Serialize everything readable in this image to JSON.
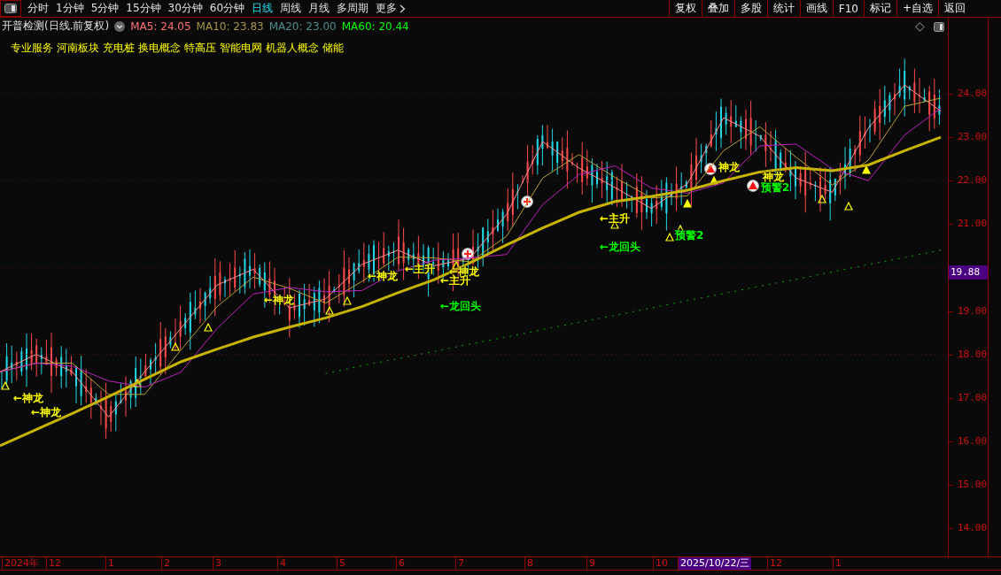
{
  "toolbar": {
    "periods": [
      {
        "label": "分时",
        "selected": false
      },
      {
        "label": "1分钟",
        "selected": false
      },
      {
        "label": "5分钟",
        "selected": false
      },
      {
        "label": "15分钟",
        "selected": false
      },
      {
        "label": "30分钟",
        "selected": false
      },
      {
        "label": "60分钟",
        "selected": false
      },
      {
        "label": "日线",
        "selected": true
      },
      {
        "label": "周线",
        "selected": false
      },
      {
        "label": "月线",
        "selected": false
      },
      {
        "label": "多周期",
        "selected": false
      },
      {
        "label": "更多",
        "selected": false
      }
    ],
    "buttons": [
      "复权",
      "叠加",
      "多股",
      "统计",
      "画线",
      "F10",
      "标记",
      "+自选",
      "返回"
    ]
  },
  "chart": {
    "title": "开普检测(日线.前复权)",
    "ma": [
      {
        "label": "MA5: 24.05",
        "color": "#ff7070"
      },
      {
        "label": "MA10: 23.83",
        "color": "#a89448"
      },
      {
        "label": "MA20: 23.00",
        "color": "#4f8c8c"
      },
      {
        "label": "MA60: 20.44",
        "color": "#00ff00"
      }
    ],
    "concepts": [
      "专业服务",
      "河南板块",
      "充电桩",
      "换电概念",
      "特高压",
      "智能电网",
      "机器人概念",
      "储能"
    ],
    "signals": [
      {
        "text": "←神龙",
        "color": "#ffff00"
      },
      {
        "text": "←神龙",
        "color": "#ffff00"
      },
      {
        "text": "←神龙",
        "color": "#ffff00"
      },
      {
        "text": "←神龙",
        "color": "#ffff00"
      },
      {
        "text": "←主升",
        "color": "#ffff00"
      },
      {
        "text": "←神龙",
        "color": "#ffff00"
      },
      {
        "text": "←主升",
        "color": "#ffff00"
      },
      {
        "text": "←龙回头",
        "color": "#00ff00"
      },
      {
        "text": "←主升",
        "color": "#ffff00"
      },
      {
        "text": "←龙回头",
        "color": "#00ff00"
      },
      {
        "text": "预警2",
        "color": "#00ff00"
      },
      {
        "text": "神龙",
        "color": "#ffff00"
      },
      {
        "text": "神龙",
        "color": "#ffff00"
      },
      {
        "text": "预警2",
        "color": "#00ff00"
      }
    ]
  },
  "chart_data": {
    "type": "line",
    "ylim": [
      13.33,
      25.75
    ],
    "grid": true,
    "yticks": [
      {
        "value": 24,
        "label": "24.00"
      },
      {
        "value": 23,
        "label": "23.00"
      },
      {
        "value": 22,
        "label": "22.00"
      },
      {
        "value": 21,
        "label": "21.00"
      },
      {
        "value": 19,
        "label": "19.00"
      },
      {
        "value": 18,
        "label": "18.00"
      },
      {
        "value": 17,
        "label": "17.00"
      },
      {
        "value": 16,
        "label": "16.00"
      },
      {
        "value": 15,
        "label": "15.00"
      },
      {
        "value": 14,
        "label": "14.00"
      }
    ],
    "series": [
      {
        "color": "#ff8a8a",
        "values": [
          17.6,
          18.0,
          17.6,
          16.56,
          17.6,
          18.6,
          19.6,
          19.96,
          19.07,
          19.28,
          20.07,
          20.4,
          20.04,
          20.22,
          21.22,
          22.9,
          22.29,
          21.84,
          21.36,
          21.93,
          23.45,
          23.02,
          22.06,
          21.73,
          23.21,
          24.2,
          23.6
        ]
      },
      {
        "color": "#b8a030",
        "values": [
          17.6,
          17.8,
          17.8,
          17.08,
          17.08,
          18.1,
          19.1,
          19.78,
          19.52,
          19.18,
          19.68,
          20.24,
          20.22,
          20.13,
          20.72,
          22.06,
          22.6,
          22.07,
          21.6,
          21.65,
          22.69,
          23.24,
          22.54,
          21.9,
          22.47,
          23.71,
          23.9
        ]
      },
      {
        "color": "#c020c0",
        "values": [
          17.6,
          17.8,
          17.73,
          17.39,
          17.25,
          17.59,
          18.6,
          19.39,
          19.54,
          19.44,
          19.47,
          19.92,
          20.17,
          20.22,
          20.3,
          21.45,
          22.14,
          22.34,
          21.83,
          21.71,
          21.95,
          22.8,
          22.84,
          22.27,
          22.0,
          23.05,
          23.67
        ]
      },
      {
        "color": "#c8b400",
        "values": [
          15.9,
          16.27,
          16.64,
          17.03,
          17.43,
          17.83,
          18.12,
          18.4,
          18.63,
          18.84,
          19.1,
          19.42,
          19.72,
          20.11,
          20.52,
          20.91,
          21.27,
          21.52,
          21.64,
          21.78,
          22.0,
          22.2,
          22.3,
          22.23,
          22.36,
          22.69,
          23.0
        ]
      },
      {
        "color": "#1aa01a",
        "line_style": "dotted",
        "values": [
          null,
          null,
          null,
          null,
          null,
          null,
          null,
          null,
          null,
          17.56,
          17.74,
          17.9,
          18.07,
          18.24,
          18.4,
          18.57,
          18.74,
          18.9,
          19.07,
          19.24,
          19.4,
          19.57,
          19.73,
          19.9,
          20.07,
          20.23,
          20.4
        ]
      }
    ]
  },
  "price_axis": {
    "current_price": "19.88"
  },
  "time_axis": [
    {
      "label": "2024年",
      "selected": false
    },
    {
      "label": "12",
      "selected": false
    },
    {
      "label": "1",
      "selected": false
    },
    {
      "label": "2",
      "selected": false
    },
    {
      "label": "3",
      "selected": false
    },
    {
      "label": "4",
      "selected": false
    },
    {
      "label": "5",
      "selected": false
    },
    {
      "label": "6",
      "selected": false
    },
    {
      "label": "7",
      "selected": false
    },
    {
      "label": "8",
      "selected": false
    },
    {
      "label": "9",
      "selected": false
    },
    {
      "label": "10",
      "selected": false
    },
    {
      "label": "2025/10/22/三",
      "selected": true
    },
    {
      "label": "12",
      "selected": false
    },
    {
      "label": "1",
      "selected": false
    }
  ]
}
